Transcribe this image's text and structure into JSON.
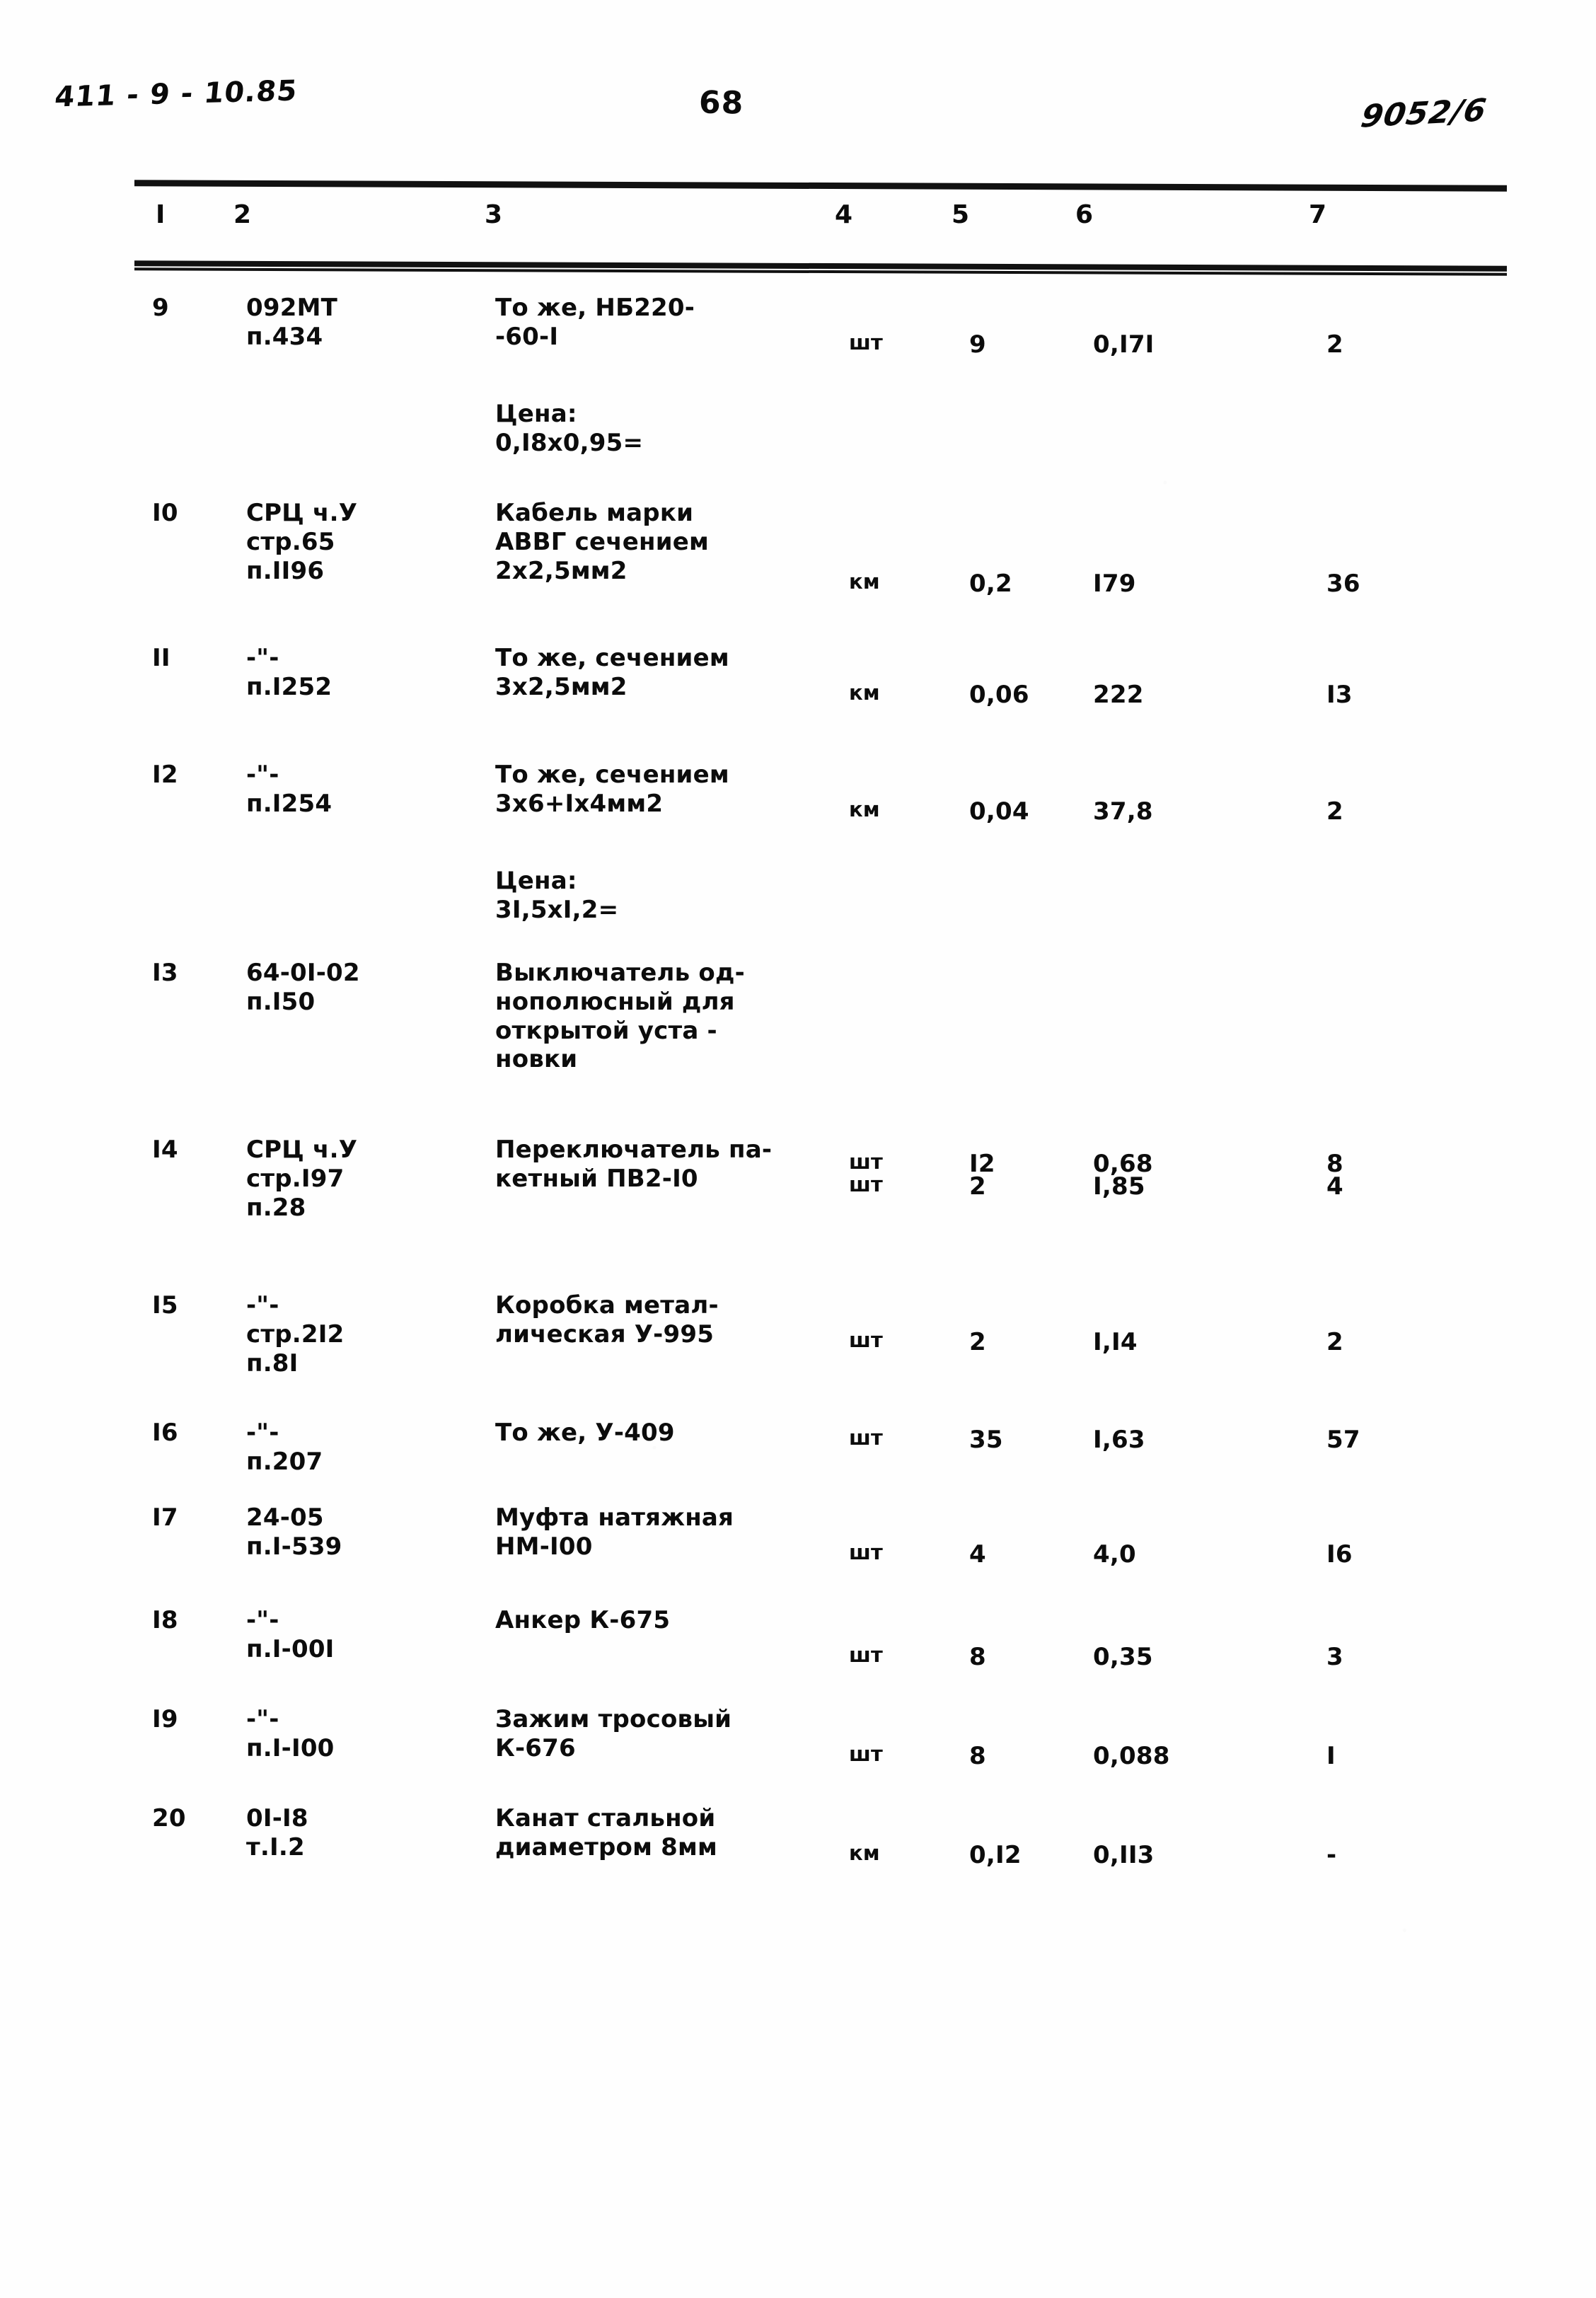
{
  "marginalia": {
    "top_left_code": "411 - 9 - 10.85",
    "page_number": "68",
    "top_right_code": "9052/6"
  },
  "table": {
    "column_headers": [
      "I",
      "2",
      "3",
      "4",
      "5",
      "6",
      "7"
    ],
    "rows": [
      {
        "c1": "9",
        "c2": "092МТ\nп.434",
        "c3": "То же, НБ220-\n-60-I",
        "c3_note": "Цена:\n0,I8х0,95=",
        "c4": "шт",
        "c5": "9",
        "c6": "0,I7I",
        "c7": "2"
      },
      {
        "c1": "I0",
        "c2": "СРЦ ч.У\nстр.65\nп.II96",
        "c3": "Кабель марки\nАВВГ сечением\n2х2,5мм2",
        "c3_note": "",
        "c4": "км",
        "c5": "0,2",
        "c6": "I79",
        "c7": "36"
      },
      {
        "c1": "II",
        "c2": "-\"-\nп.I252",
        "c3": "То же, сечением\n3х2,5мм2",
        "c3_note": "",
        "c4": "км",
        "c5": "0,06",
        "c6": "222",
        "c7": "I3"
      },
      {
        "c1": "I2",
        "c2": "-\"-\nп.I254",
        "c3": "То же, сечением\n3х6+Iх4мм2",
        "c3_note": "Цена:\n3I,5хI,2=",
        "c4": "км",
        "c5": "0,04",
        "c6": "37,8",
        "c7": "2"
      },
      {
        "c1": "I3",
        "c2": "64-0I-02\nп.I50",
        "c3": "Выключатель од-\nнополюсный для\nоткрытой уста -\nновки",
        "c3_note": "",
        "c4": "шт",
        "c5": "I2",
        "c6": "0,68",
        "c7": "8"
      },
      {
        "c1": "I4",
        "c2": "СРЦ ч.У\nстр.I97\nп.28",
        "c3": "Переключатель па-\nкетный ПВ2-I0",
        "c3_note": "",
        "c4": "шт",
        "c5": "2",
        "c6": "I,85",
        "c7": "4"
      },
      {
        "c1": "I5",
        "c2": "-\"-\nстр.2I2\nп.8I",
        "c3": "Коробка метал-\nлическая У-995",
        "c3_note": "",
        "c4": "шт",
        "c5": "2",
        "c6": "I,I4",
        "c7": "2"
      },
      {
        "c1": "I6",
        "c2": "-\"-\nп.207",
        "c3": "То же, У-409",
        "c3_note": "",
        "c4": "шт",
        "c5": "35",
        "c6": "I,63",
        "c7": "57"
      },
      {
        "c1": "I7",
        "c2": "24-05\nп.I-539",
        "c3": "Муфта натяжная\nНМ-I00",
        "c3_note": "",
        "c4": "шт",
        "c5": "4",
        "c6": "4,0",
        "c7": "I6"
      },
      {
        "c1": "I8",
        "c2": "-\"-\nп.I-00I",
        "c3": "Анкер К-675",
        "c3_note": "",
        "c4": "шт",
        "c5": "8",
        "c6": "0,35",
        "c7": "3"
      },
      {
        "c1": "I9",
        "c2": "-\"-\nп.I-I00",
        "c3": "Зажим тросовый\nК-676",
        "c3_note": "",
        "c4": "шт",
        "c5": "8",
        "c6": "0,088",
        "c7": "I"
      },
      {
        "c1": "20",
        "c2": "0I-I8\nт.I.2",
        "c3": "Канат стальной\nдиаметром 8мм",
        "c3_note": "",
        "c4": "км",
        "c5": "0,I2",
        "c6": "0,II3",
        "c7": "-"
      }
    ]
  }
}
